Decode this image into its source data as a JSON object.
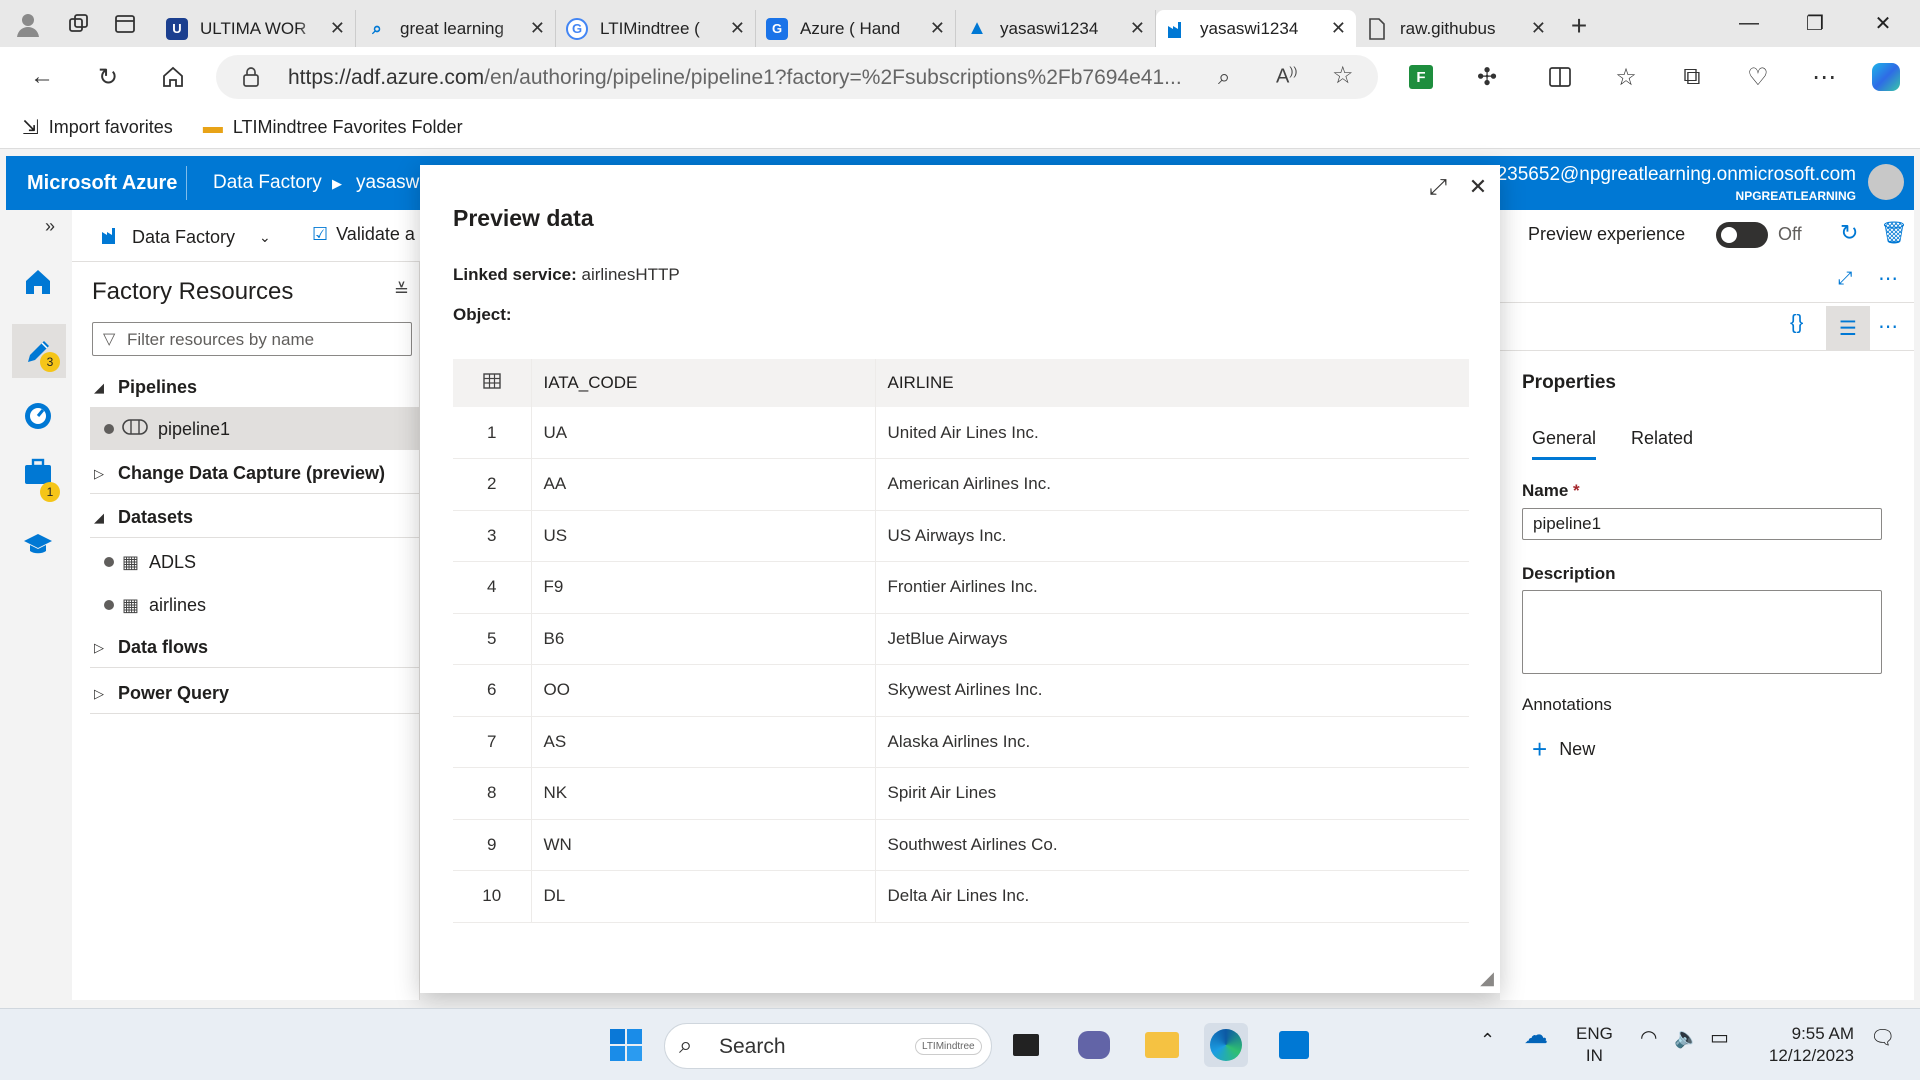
{
  "browser": {
    "tabs": [
      {
        "label": "ULTIMA WOR",
        "icon": "u-favicon",
        "color": "#1b3f8f"
      },
      {
        "label": "great learning",
        "icon": "search-favicon",
        "color": "#0078d4"
      },
      {
        "label": "LTIMindtree (",
        "icon": "g-favicon",
        "color": "#4285f4"
      },
      {
        "label": "Azure ( Hand",
        "icon": "g-favicon",
        "color": "#1a73e8"
      },
      {
        "label": "yasaswi1234",
        "icon": "azure-favicon",
        "color": "#0078d4"
      },
      {
        "label": "yasaswi1234",
        "icon": "data-factory-favicon",
        "color": "#0078d4"
      },
      {
        "label": "raw.githubus",
        "icon": "document-favicon",
        "color": "#555555"
      }
    ],
    "url_host": "https://adf.azure.com",
    "url_path": "/en/authoring/pipeline/pipeline1?factory=%2Fsubscriptions%2Fb7694e41...",
    "favorites": [
      {
        "label": "Import favorites",
        "icon": "import-icon"
      },
      {
        "label": "LTIMindtree Favorites Folder",
        "icon": "folder-icon"
      }
    ]
  },
  "azure": {
    "brand": "Microsoft Azure",
    "breadcrumb_service": "Data Factory",
    "breadcrumb_factory": "yasaswi",
    "account_email": "235652@npgreatlearning.onmicrosoft.com",
    "account_tenant": "NPGREATLEARNING",
    "accent": "#0078d4"
  },
  "rail": {
    "author_badge": "3",
    "manage_badge": "1"
  },
  "toolbar": {
    "factory_label": "Data Factory",
    "validate_label": "Validate a",
    "preview_experience_label": "Preview experience",
    "preview_experience_state": "Off"
  },
  "resources": {
    "title": "Factory Resources",
    "filter_placeholder": "Filter resources by name",
    "sections": [
      {
        "label": "Pipelines",
        "expanded": true
      },
      {
        "label": "Change Data Capture (preview)",
        "expanded": false
      },
      {
        "label": "Datasets",
        "expanded": true
      },
      {
        "label": "Data flows",
        "expanded": false
      },
      {
        "label": "Power Query",
        "expanded": false
      }
    ],
    "pipeline_item": "pipeline1",
    "dataset_items": [
      "ADLS",
      "airlines"
    ]
  },
  "properties": {
    "title": "Properties",
    "tab_general": "General",
    "tab_related": "Related",
    "name_label": "Name",
    "name_value": "pipeline1",
    "description_label": "Description",
    "annotations_label": "Annotations",
    "new_label": "New"
  },
  "modal": {
    "title": "Preview data",
    "linked_service_label": "Linked service:",
    "linked_service_value": "airlinesHTTP",
    "object_label": "Object:",
    "columns": [
      "IATA_CODE",
      "AIRLINE"
    ],
    "rows": [
      {
        "n": "1",
        "code": "UA",
        "airline": "United Air Lines Inc."
      },
      {
        "n": "2",
        "code": "AA",
        "airline": "American Airlines Inc."
      },
      {
        "n": "3",
        "code": "US",
        "airline": "US Airways Inc."
      },
      {
        "n": "4",
        "code": "F9",
        "airline": "Frontier Airlines Inc."
      },
      {
        "n": "5",
        "code": "B6",
        "airline": "JetBlue Airways"
      },
      {
        "n": "6",
        "code": "OO",
        "airline": "Skywest Airlines Inc."
      },
      {
        "n": "7",
        "code": "AS",
        "airline": "Alaska Airlines Inc."
      },
      {
        "n": "8",
        "code": "NK",
        "airline": "Spirit Air Lines"
      },
      {
        "n": "9",
        "code": "WN",
        "airline": "Southwest Airlines Co."
      },
      {
        "n": "10",
        "code": "DL",
        "airline": "Delta Air Lines Inc."
      }
    ]
  },
  "taskbar": {
    "search_label": "Search",
    "search_badge": "LTIMindtree",
    "lang_line1": "ENG",
    "lang_line2": "IN",
    "time": "9:55 AM",
    "date": "12/12/2023"
  }
}
